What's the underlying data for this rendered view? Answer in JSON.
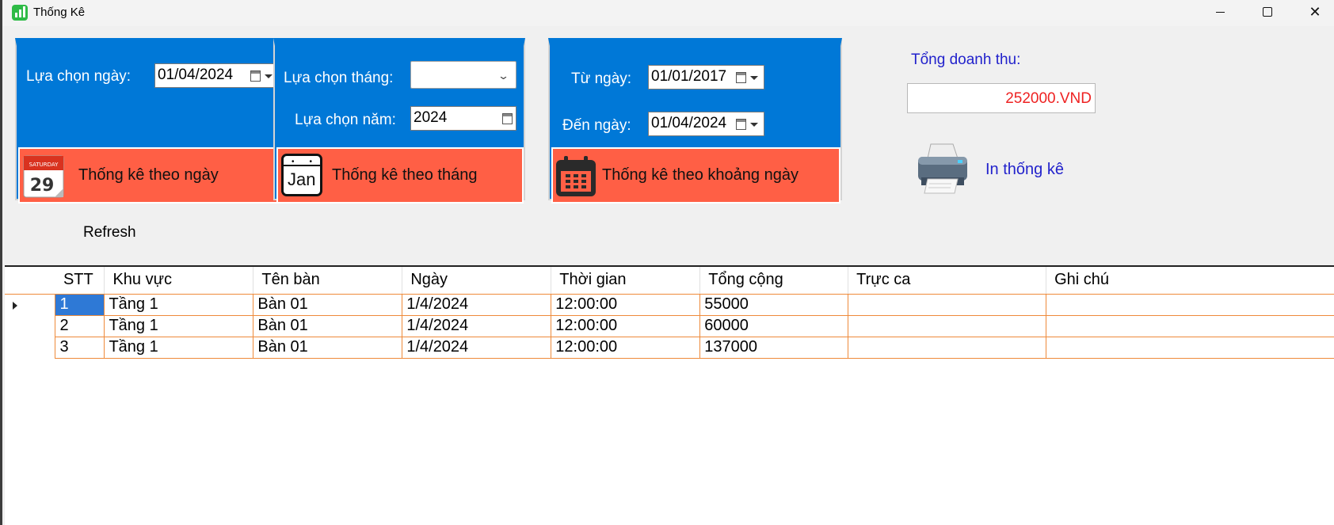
{
  "window": {
    "title": "Thống Kê"
  },
  "panel_day": {
    "label": "Lựa chọn ngày:",
    "date_value": "01/04/2024",
    "button_label": "Thống kê theo ngày",
    "icon_day_text": "SATURDAY",
    "icon_day_number": "29"
  },
  "panel_month": {
    "month_label": "Lựa chọn tháng:",
    "month_value": "",
    "year_label": "Lựa chọn năm:",
    "year_value": "2024",
    "button_label": "Thống kê theo tháng",
    "icon_month_text": "Jan"
  },
  "panel_range": {
    "from_label": "Từ ngày:",
    "from_value": "01/01/2017",
    "to_label": "Đến ngày:",
    "to_value": "01/04/2024",
    "button_label": "Thống kê theo khoảng ngày"
  },
  "revenue": {
    "label": "Tổng doanh thu:",
    "value": "252000.VND"
  },
  "print": {
    "label": "In thống kê"
  },
  "refresh": {
    "label": "Refresh"
  },
  "grid": {
    "columns": [
      "STT",
      "Khu vực",
      "Tên bàn",
      "Ngày",
      "Thời gian",
      "Tổng cộng",
      "Trực ca",
      "Ghi chú"
    ],
    "rows": [
      [
        "1",
        "Tầng 1",
        "Bàn 01",
        "1/4/2024",
        "12:00:00",
        "55000",
        "",
        ""
      ],
      [
        "2",
        "Tầng 1",
        "Bàn 01",
        "1/4/2024",
        "12:00:00",
        "60000",
        "",
        ""
      ],
      [
        "3",
        "Tầng 1",
        "Bàn 01",
        "1/4/2024",
        "12:00:00",
        "137000",
        "",
        ""
      ]
    ]
  },
  "colors": {
    "panel_blue": "#0078d7",
    "button_red": "#ff5f45",
    "grid_line_orange": "#ee8a3a",
    "link_blue": "#2222cc",
    "revenue_red": "#ee2222",
    "selection_blue": "#2e79d6"
  }
}
